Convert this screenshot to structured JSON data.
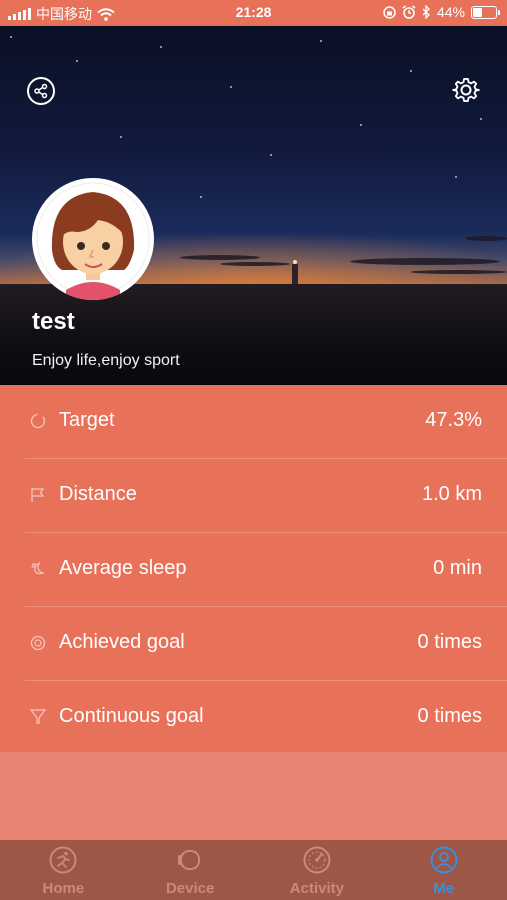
{
  "status_bar": {
    "carrier": "中国移动",
    "time": "21:28",
    "battery_percent": "44%",
    "battery_level": 0.44,
    "icons": [
      "signal-icon",
      "wifi-icon",
      "lock-rotation-icon",
      "alarm-icon",
      "bluetooth-icon",
      "battery-icon"
    ]
  },
  "header": {
    "share_icon": "share-icon",
    "settings_icon": "gear-icon",
    "username": "test",
    "motto": "Enjoy life,enjoy sport"
  },
  "stats": [
    {
      "icon": "target-icon",
      "label": "Target",
      "value": "47.3%"
    },
    {
      "icon": "flag-icon",
      "label": "Distance",
      "value": "1.0 km"
    },
    {
      "icon": "sleep-icon",
      "label": "Average sleep",
      "value": "0 min"
    },
    {
      "icon": "medal-icon",
      "label": "Achieved goal",
      "value": "0 times"
    },
    {
      "icon": "trophy-icon",
      "label": "Continuous goal",
      "value": "0 times"
    }
  ],
  "tabs": [
    {
      "icon": "run-icon",
      "label": "Home",
      "active": false
    },
    {
      "icon": "watch-icon",
      "label": "Device",
      "active": false
    },
    {
      "icon": "gauge-icon",
      "label": "Activity",
      "active": false
    },
    {
      "icon": "user-icon",
      "label": "Me",
      "active": true
    }
  ],
  "colors": {
    "accent": "#e8715a",
    "tab_bar": "#9e5646",
    "active_tab": "#3b8fdc"
  }
}
